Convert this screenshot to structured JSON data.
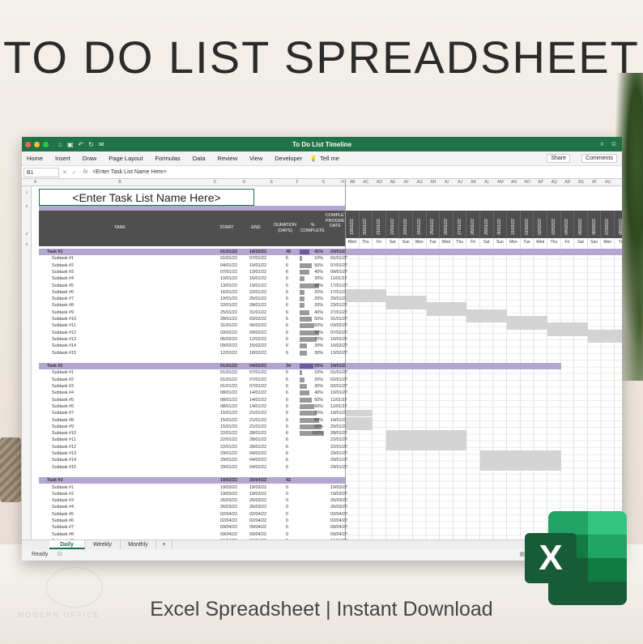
{
  "headline": "TO DO LIST SPREADSHEET",
  "footer": "Excel Spreadsheet | Instant Download",
  "watermark": "MODERN OFFICE",
  "window": {
    "title": "To Do List Timeline",
    "menus": [
      "Home",
      "Insert",
      "Draw",
      "Page Layout",
      "Formulas",
      "Data",
      "Review",
      "View",
      "Developer"
    ],
    "tell_me": "Tell me",
    "share": "Share",
    "comments": "Comments",
    "name_box": "B1",
    "fx": "fx",
    "formula": "<Enter Task List Name Here>"
  },
  "columns": [
    "A",
    "B",
    "C",
    "D",
    "E",
    "F",
    "G",
    "H",
    "AB",
    "AC",
    "AD",
    "AE",
    "AF",
    "AG",
    "AH",
    "AI",
    "AJ",
    "AK",
    "AL",
    "AM",
    "AN",
    "AO",
    "AP",
    "AQ",
    "AR",
    "AS",
    "AT",
    "AU"
  ],
  "sheet": {
    "task_list_name": "<Enter Task List Name Here>",
    "headers": {
      "task": "TASK",
      "start": "START",
      "end": "END",
      "duration": "DURATION (DAYS)",
      "complete": "% COMPLETE",
      "completion": "COMPLETION PROGRESS DATE"
    },
    "dates": [
      "19/01/22",
      "20/01/22",
      "21/01/22",
      "22/01/22",
      "23/01/22",
      "24/01/22",
      "25/01/22",
      "26/01/22",
      "27/01/22",
      "28/01/22",
      "29/01/22",
      "30/01/22",
      "31/01/22",
      "01/02/22",
      "02/02/22",
      "03/02/22",
      "04/02/22",
      "05/02/22",
      "06/02/22",
      "07/02/22",
      "08/02/22"
    ],
    "days": [
      "Wed",
      "Thu",
      "Fri",
      "Sat",
      "Sun",
      "Mon",
      "Tue",
      "Wed",
      "Thu",
      "Fri",
      "Sat",
      "Sun",
      "Mon",
      "Tue",
      "Wed",
      "Thu",
      "Fri",
      "Sat",
      "Sun",
      "Mon",
      "Tu"
    ],
    "row_numbers": [
      "1",
      "2",
      "3",
      "4",
      "6",
      "7",
      "8",
      "9",
      "10",
      "11",
      "12",
      "13",
      "14",
      "15",
      "16",
      "17",
      "18",
      "19",
      "20",
      "21",
      "23",
      "24",
      "25",
      "26",
      "27",
      "28",
      "29",
      "30",
      "31",
      "32",
      "33",
      "34",
      "35",
      "36",
      "37",
      "38",
      "40",
      "41",
      "42",
      "43",
      "44",
      "45",
      "46",
      "47",
      "48",
      "49"
    ],
    "rows": [
      {
        "task": "Task #1",
        "start": "01/01/22",
        "end": "18/02/22",
        "dur": "48",
        "pct": "41%",
        "done": "20/01/22",
        "level": "task"
      },
      {
        "task": "Subtask #1",
        "start": "01/01/22",
        "end": "07/01/22",
        "dur": "6",
        "pct": "10%",
        "done": "01/01/22"
      },
      {
        "task": "Subtask #2",
        "start": "04/01/22",
        "end": "10/01/22",
        "dur": "6",
        "pct": "50%",
        "done": "07/01/22"
      },
      {
        "task": "Subtask #3",
        "start": "07/01/22",
        "end": "13/01/22",
        "dur": "6",
        "pct": "40%",
        "done": "09/01/22"
      },
      {
        "task": "Subtask #4",
        "start": "10/01/22",
        "end": "16/01/22",
        "dur": "6",
        "pct": "20%",
        "done": "11/01/22"
      },
      {
        "task": "Subtask #5",
        "start": "13/01/22",
        "end": "19/01/22",
        "dur": "6",
        "pct": "80%",
        "done": "17/01/22"
      },
      {
        "task": "Subtask #6",
        "start": "16/01/22",
        "end": "22/01/22",
        "dur": "6",
        "pct": "20%",
        "done": "17/01/22"
      },
      {
        "task": "Subtask #7",
        "start": "19/01/22",
        "end": "25/01/22",
        "dur": "6",
        "pct": "20%",
        "done": "20/01/22"
      },
      {
        "task": "Subtask #8",
        "start": "22/01/22",
        "end": "28/01/22",
        "dur": "6",
        "pct": "20%",
        "done": "23/01/22"
      },
      {
        "task": "Subtask #9",
        "start": "25/01/22",
        "end": "31/01/22",
        "dur": "6",
        "pct": "40%",
        "done": "27/01/22"
      },
      {
        "task": "Subtask #10",
        "start": "28/01/22",
        "end": "03/02/22",
        "dur": "6",
        "pct": "50%",
        "done": "31/01/22"
      },
      {
        "task": "Subtask #11",
        "start": "31/01/22",
        "end": "06/02/22",
        "dur": "6",
        "pct": "60%",
        "done": "03/02/22"
      },
      {
        "task": "Subtask #12",
        "start": "03/02/22",
        "end": "09/02/22",
        "dur": "6",
        "pct": "80%",
        "done": "07/02/22"
      },
      {
        "task": "Subtask #13",
        "start": "06/02/22",
        "end": "12/02/22",
        "dur": "6",
        "pct": "70%",
        "done": "10/02/22"
      },
      {
        "task": "Subtask #14",
        "start": "09/02/22",
        "end": "15/02/22",
        "dur": "6",
        "pct": "30%",
        "done": "10/02/22"
      },
      {
        "task": "Subtask #15",
        "start": "12/02/22",
        "end": "18/02/22",
        "dur": "6",
        "pct": "30%",
        "done": "13/02/22"
      },
      {
        "task": "Task #2",
        "start": "01/01/22",
        "end": "04/02/22",
        "dur": "34",
        "pct": "55%",
        "done": "19/01/22",
        "level": "task"
      },
      {
        "task": "Subtask #1",
        "start": "01/01/22",
        "end": "07/01/22",
        "dur": "6",
        "pct": "10%",
        "done": "01/01/22"
      },
      {
        "task": "Subtask #2",
        "start": "01/01/22",
        "end": "07/01/22",
        "dur": "6",
        "pct": "20%",
        "done": "02/01/22"
      },
      {
        "task": "Subtask #3",
        "start": "01/01/22",
        "end": "07/01/22",
        "dur": "6",
        "pct": "30%",
        "done": "02/01/22"
      },
      {
        "task": "Subtask #4",
        "start": "08/01/22",
        "end": "14/01/22",
        "dur": "6",
        "pct": "40%",
        "done": "10/01/22"
      },
      {
        "task": "Subtask #5",
        "start": "08/01/22",
        "end": "14/01/22",
        "dur": "6",
        "pct": "50%",
        "done": "11/01/22"
      },
      {
        "task": "Subtask #6",
        "start": "08/01/22",
        "end": "14/01/22",
        "dur": "6",
        "pct": "60%",
        "done": "11/01/22"
      },
      {
        "task": "Subtask #7",
        "start": "15/01/22",
        "end": "21/01/22",
        "dur": "6",
        "pct": "70%",
        "done": "19/01/22"
      },
      {
        "task": "Subtask #8",
        "start": "15/01/22",
        "end": "21/01/22",
        "dur": "6",
        "pct": "80%",
        "done": "19/01/22"
      },
      {
        "task": "Subtask #9",
        "start": "15/01/22",
        "end": "21/01/22",
        "dur": "6",
        "pct": "90%",
        "done": "20/01/22"
      },
      {
        "task": "Subtask #10",
        "start": "22/01/22",
        "end": "28/01/22",
        "dur": "6",
        "pct": "100%",
        "done": "28/01/22"
      },
      {
        "task": "Subtask #11",
        "start": "22/01/22",
        "end": "28/01/22",
        "dur": "6",
        "pct": "",
        "done": "22/01/22"
      },
      {
        "task": "Subtask #12",
        "start": "22/01/22",
        "end": "28/01/22",
        "dur": "6",
        "pct": "",
        "done": "22/01/22"
      },
      {
        "task": "Subtask #13",
        "start": "29/01/22",
        "end": "04/02/22",
        "dur": "6",
        "pct": "",
        "done": "29/01/22"
      },
      {
        "task": "Subtask #14",
        "start": "29/01/22",
        "end": "04/02/22",
        "dur": "6",
        "pct": "",
        "done": "29/01/22"
      },
      {
        "task": "Subtask #15",
        "start": "29/01/22",
        "end": "04/02/22",
        "dur": "6",
        "pct": "",
        "done": "29/01/22"
      },
      {
        "task": "Task #3",
        "start": "19/03/22",
        "end": "30/04/22",
        "dur": "42",
        "pct": "",
        "done": "",
        "level": "task"
      },
      {
        "task": "Subtask #1",
        "start": "19/03/22",
        "end": "19/03/22",
        "dur": "0",
        "pct": "",
        "done": "19/03/22"
      },
      {
        "task": "Subtask #2",
        "start": "19/03/22",
        "end": "19/03/22",
        "dur": "0",
        "pct": "",
        "done": "19/03/22"
      },
      {
        "task": "Subtask #3",
        "start": "26/03/22",
        "end": "26/03/22",
        "dur": "0",
        "pct": "",
        "done": "26/03/22"
      },
      {
        "task": "Subtask #4",
        "start": "26/03/22",
        "end": "26/03/22",
        "dur": "0",
        "pct": "",
        "done": "26/03/22"
      },
      {
        "task": "Subtask #5",
        "start": "02/04/22",
        "end": "02/04/22",
        "dur": "0",
        "pct": "",
        "done": "02/04/22"
      },
      {
        "task": "Subtask #6",
        "start": "02/04/22",
        "end": "02/04/22",
        "dur": "0",
        "pct": "",
        "done": "02/04/22"
      },
      {
        "task": "Subtask #7",
        "start": "09/04/22",
        "end": "09/04/22",
        "dur": "0",
        "pct": "",
        "done": "09/04/22"
      },
      {
        "task": "Subtask #8",
        "start": "09/04/22",
        "end": "09/04/22",
        "dur": "0",
        "pct": "",
        "done": "09/04/22"
      },
      {
        "task": "Subtask #9",
        "start": "16/04/22",
        "end": "16/04/22",
        "dur": "0",
        "pct": "",
        "done": "16/04/22"
      }
    ]
  },
  "tabs": [
    "Daily",
    "Weekly",
    "Monthly",
    "+"
  ],
  "status": {
    "ready": "Ready"
  },
  "logo_letter": "X"
}
